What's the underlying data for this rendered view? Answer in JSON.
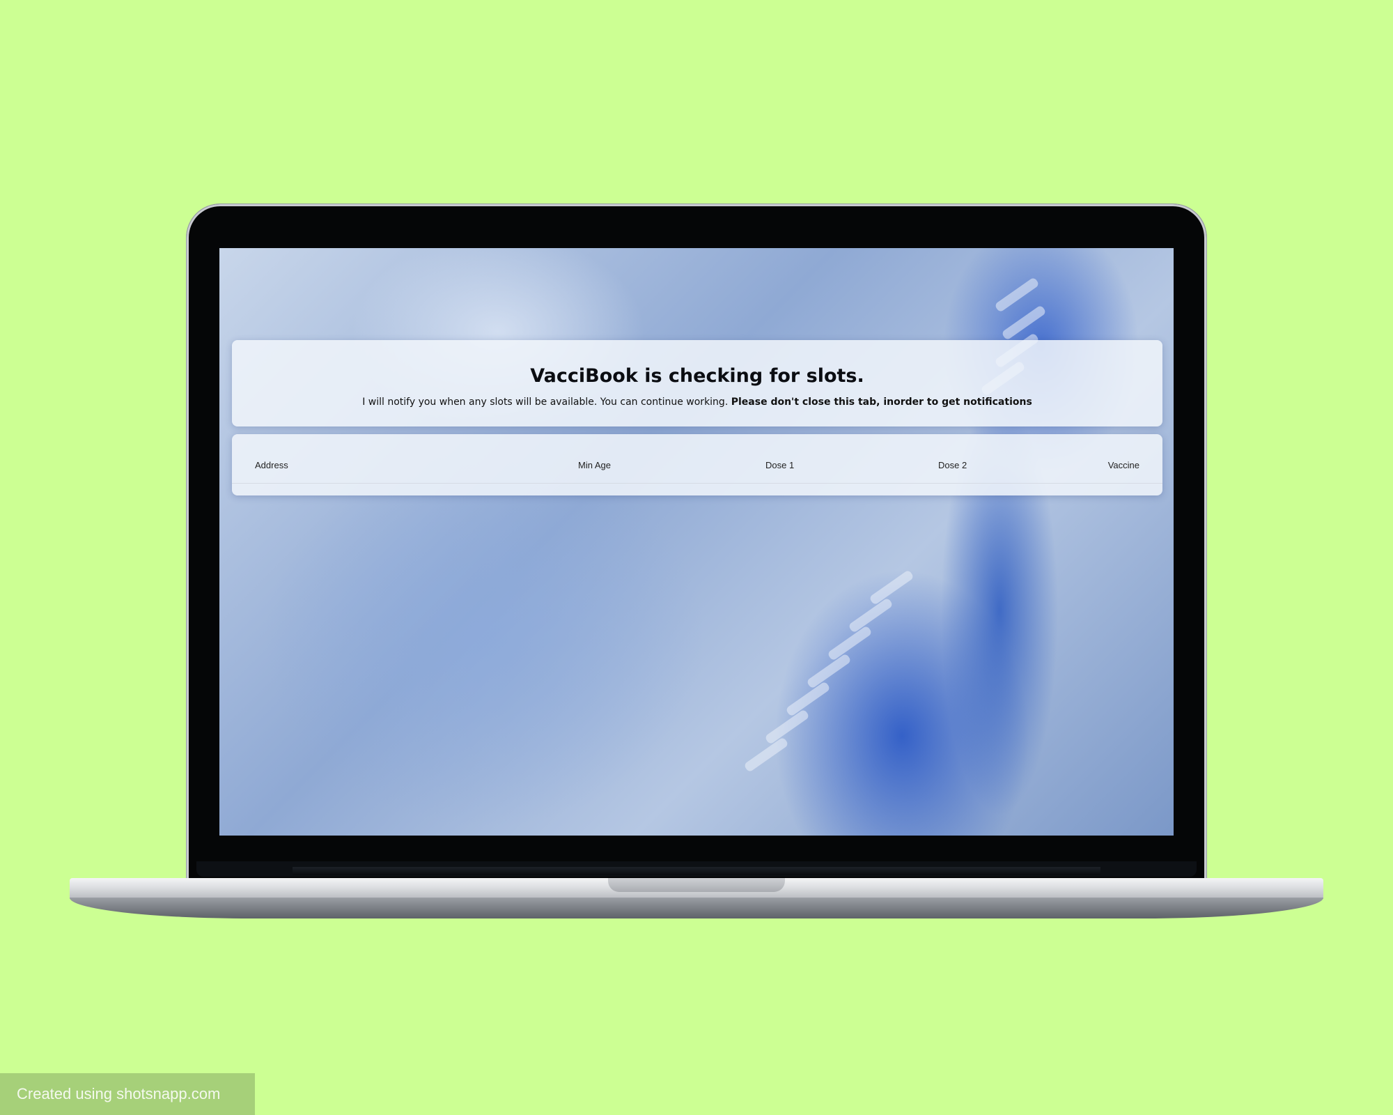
{
  "app": {
    "title": "VacciBook is checking for slots.",
    "message_normal": "I will notify you when any slots will be available. You can continue working.",
    "message_bold": "Please don't close this tab, inorder to get notifications"
  },
  "table": {
    "columns": [
      "Address",
      "Min Age",
      "Dose 1",
      "Dose 2",
      "Vaccine"
    ]
  },
  "background": {
    "description_icon": "dna-helix-background"
  },
  "watermark": {
    "text": "Created using shotsnapp.com"
  },
  "colors": {
    "page_background": "#ccff93",
    "accent_dna": "#1f4fbf"
  }
}
